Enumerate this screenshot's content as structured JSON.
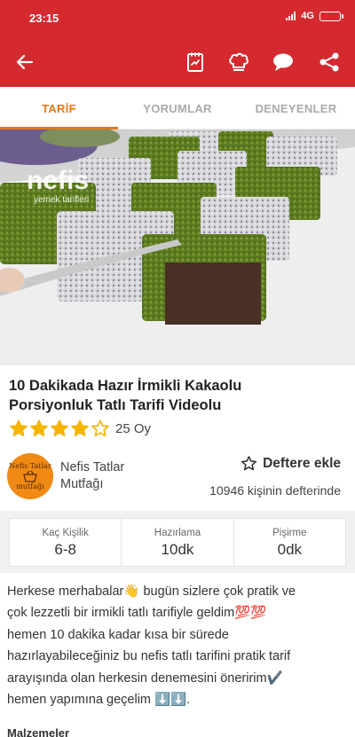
{
  "status_bar": {
    "time": "23:15",
    "network": "4G"
  },
  "toolbar": {
    "icons": [
      "back-arrow-icon",
      "shopping-list-icon",
      "chef-hat-icon",
      "comment-icon",
      "share-icon"
    ]
  },
  "tabs": [
    "TARİF",
    "YORUMLAR",
    "DENEYENLER"
  ],
  "hero": {
    "watermark_brand": "nefis",
    "watermark_sub": "yemek tarifleri"
  },
  "recipe": {
    "title_line1": "10 Dakikada Hazır İrmikli Kakaolu",
    "title_line2": "Porsiyonluk Tatlı Tarifi Videolu",
    "rating": 4,
    "rating_max": 5,
    "rating_count": "25 Oy"
  },
  "author": {
    "logo_line1": "Nefis Tatlar",
    "logo_line2": "mutfağı",
    "name_line1": "Nefis Tatlar",
    "name_line2": "Mutfağı"
  },
  "save": {
    "label": "Deftere ekle",
    "count_text": "10946 kişinin defterinde"
  },
  "info": [
    {
      "label": "Kaç Kişilik",
      "value": "6-8"
    },
    {
      "label": "Hazırlama",
      "value": "10dk"
    },
    {
      "label": "Pişirme",
      "value": "0dk"
    }
  ],
  "description": [
    "Herkese merhabalar👋 bugün sizlere çok pratik ve",
    "çok lezzetli bir irmikli tatlı tarifiyle geldim💯💯",
    "hemen 10 dakika kadar kısa bir sürede",
    "hazırlayabileceğiniz bu nefis tatlı tarifini pratik tarif",
    "arayışında olan herkesin denemesini öneririm✔️",
    "hemen yapımına geçelim ⬇️⬇️."
  ],
  "section_title": "Malzemeler",
  "colors": {
    "primary": "#d42a2f",
    "accent": "#e3791d",
    "star": "#f5b400"
  }
}
